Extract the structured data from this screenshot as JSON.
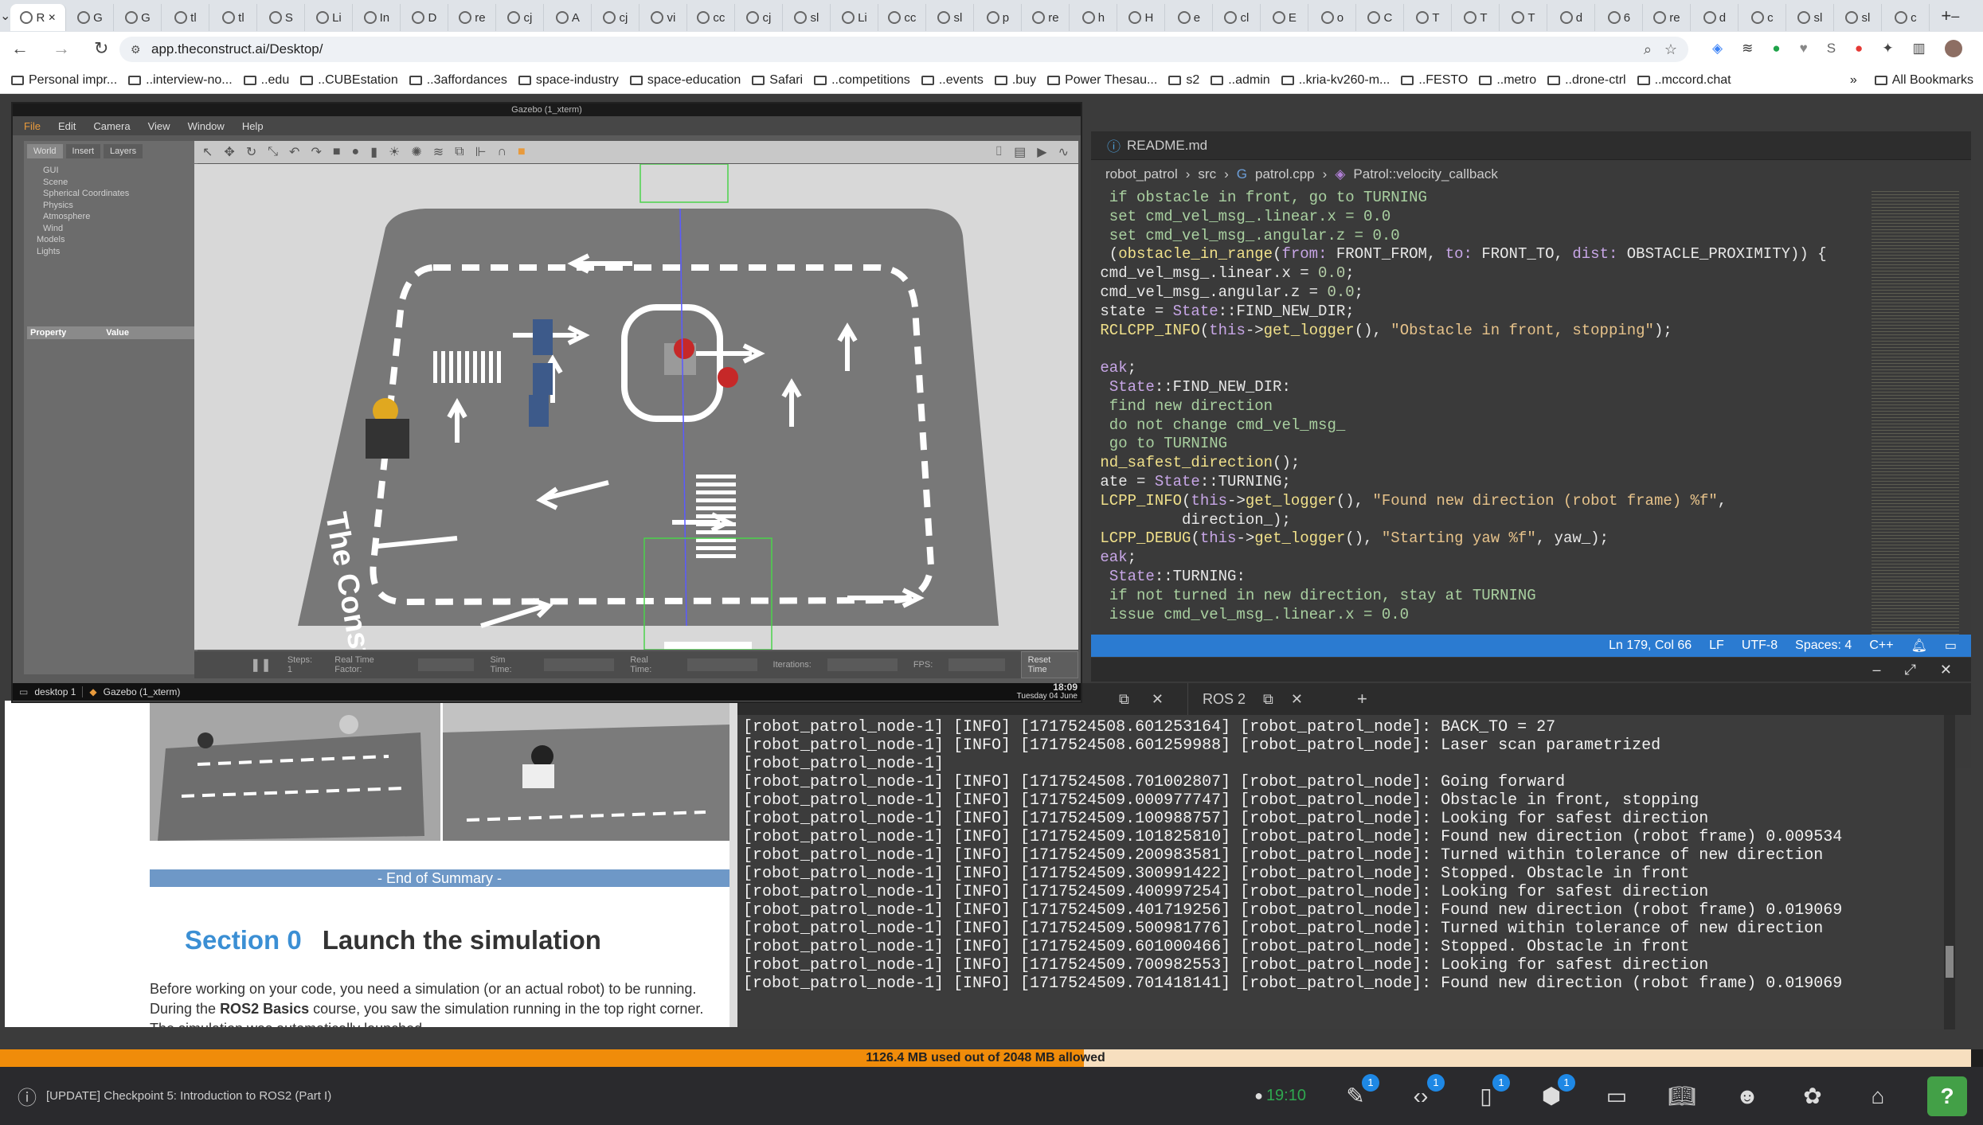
{
  "browser": {
    "tabs": [
      "R",
      "G",
      "G",
      "tl",
      "tl",
      "S",
      "Li",
      "In",
      "D",
      "re",
      "cj",
      "A",
      "cj",
      "vi",
      "cc",
      "cj",
      "sl",
      "Li",
      "cc",
      "sl",
      "p",
      "re",
      "h",
      "H",
      "e",
      "cl",
      "E",
      "o",
      "C",
      "T",
      "T",
      "T",
      "d",
      "6",
      "re",
      "d",
      "c",
      "sl",
      "sl",
      "c"
    ],
    "url": "app.theconstruct.ai/Desktop/",
    "bookmarks": [
      "Personal impr...",
      "..interview-no...",
      "..edu",
      "..CUBEstation",
      "..3affordances",
      "space-industry",
      "space-education",
      "Safari",
      "..competitions",
      "..events",
      ".buy",
      "Power Thesau...",
      "s2",
      "..admin",
      "..kria-kv260-m...",
      "..FESTO",
      "..metro",
      "..drone-ctrl",
      "..mccord.chat"
    ],
    "all_bookmarks": "All Bookmarks"
  },
  "gazebo": {
    "title": "Gazebo (1_xterm)",
    "menu": [
      "File",
      "Edit",
      "Camera",
      "View",
      "Window",
      "Help"
    ],
    "left_tabs": [
      "World",
      "Insert",
      "Layers"
    ],
    "tree": [
      "GUI",
      "Scene",
      "Spherical Coordinates",
      "Physics",
      "Atmosphere",
      "Wind",
      "Models",
      "Lights"
    ],
    "prop_headers": [
      "Property",
      "Value"
    ],
    "bottom": {
      "steps": "Steps: 1",
      "rtf": "Real Time Factor:",
      "sim": "Sim Time:",
      "real": "Real Time:",
      "iter": "Iterations:",
      "fps": "FPS:",
      "reset": "Reset Time"
    },
    "taskbar": {
      "desktop": "desktop 1",
      "window": "Gazebo (1_xterm)",
      "time": "18:09",
      "date": "Tuesday 04 June"
    },
    "brand": "The Construct"
  },
  "editor": {
    "tab": "README.md",
    "breadcrumb": [
      "robot_patrol",
      "src",
      "patrol.cpp",
      "Patrol::velocity_callback"
    ],
    "status": [
      "Ln 179, Col 66",
      "LF",
      "UTF-8",
      "Spaces: 4",
      "C++"
    ]
  },
  "terminal": {
    "tab": "ROS 2",
    "lines": [
      "[robot_patrol_node-1] [INFO] [1717524508.601253164] [robot_patrol_node]: BACK_TO = 27",
      "[robot_patrol_node-1] [INFO] [1717524508.601259988] [robot_patrol_node]: Laser scan parametrized",
      "[robot_patrol_node-1]",
      "[robot_patrol_node-1] [INFO] [1717524508.701002807] [robot_patrol_node]: Going forward",
      "[robot_patrol_node-1] [INFO] [1717524509.000977747] [robot_patrol_node]: Obstacle in front, stopping",
      "[robot_patrol_node-1] [INFO] [1717524509.100988757] [robot_patrol_node]: Looking for safest direction",
      "[robot_patrol_node-1] [INFO] [1717524509.101825810] [robot_patrol_node]: Found new direction (robot frame) 0.009534",
      "[robot_patrol_node-1] [INFO] [1717524509.200983581] [robot_patrol_node]: Turned within tolerance of new direction",
      "[robot_patrol_node-1] [INFO] [1717524509.300991422] [robot_patrol_node]: Stopped. Obstacle in front",
      "[robot_patrol_node-1] [INFO] [1717524509.400997254] [robot_patrol_node]: Looking for safest direction",
      "[robot_patrol_node-1] [INFO] [1717524509.401719256] [robot_patrol_node]: Found new direction (robot frame) 0.019069",
      "[robot_patrol_node-1] [INFO] [1717524509.500981776] [robot_patrol_node]: Turned within tolerance of new direction",
      "[robot_patrol_node-1] [INFO] [1717524509.601000466] [robot_patrol_node]: Stopped. Obstacle in front",
      "[robot_patrol_node-1] [INFO] [1717524509.700982553] [robot_patrol_node]: Looking for safest direction",
      "[robot_patrol_node-1] [INFO] [1717524509.701418141] [robot_patrol_node]: Found new direction (robot frame) 0.019069"
    ]
  },
  "notes": {
    "end_summary": "- End of Summary -",
    "section_num": "Section 0",
    "section_title": "Launch the simulation",
    "para1": "Before working on your code, you need a simulation (or an actual robot) to be running.",
    "para2a": "During the ",
    "para2b": "ROS2 Basics",
    "para2c": " course, you saw the simulation running in the top right corner.",
    "para3": "The simulation was automatically launched"
  },
  "memory": {
    "text": "1126.4 MB used out of 2048 MB allowed",
    "used_fraction": 0.55
  },
  "appbar": {
    "update": "[UPDATE] Checkpoint 5: Introduction to ROS2 (Part I)",
    "clock": "19:10",
    "badges": [
      "1",
      "1",
      "1",
      "1"
    ]
  },
  "colors": {
    "accent": "#2b7bd1",
    "memory": "#f08c0a",
    "section": "#3b8fd4"
  }
}
